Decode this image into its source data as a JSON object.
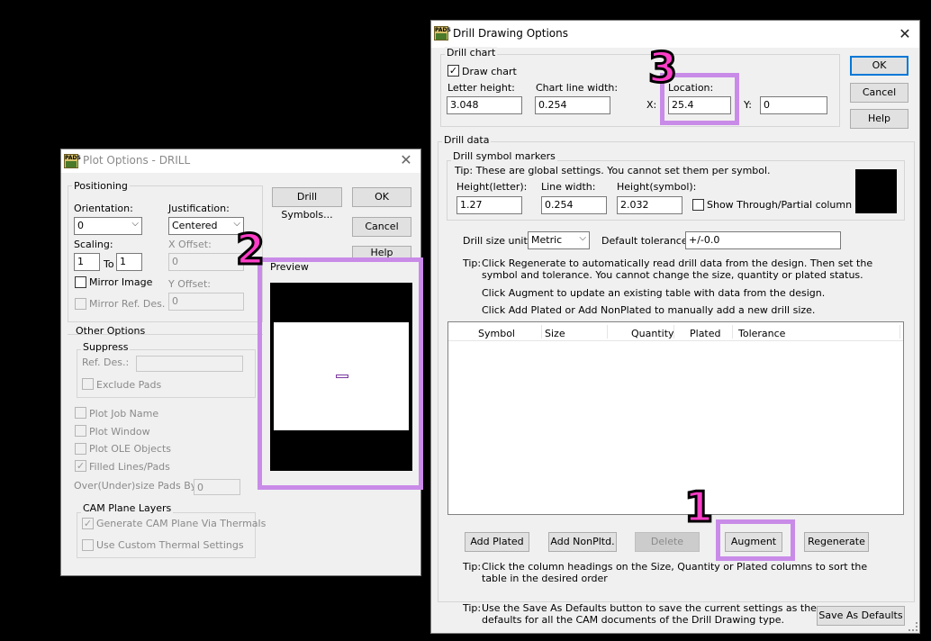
{
  "plot_options": {
    "title": "Plot Options - DRILL",
    "positioning": {
      "label": "Positioning",
      "orientation_label": "Orientation:",
      "orientation_value": "0",
      "justification_label": "Justification:",
      "justification_value": "Centered",
      "scaling_label": "Scaling:",
      "scale_from": "1",
      "scale_to_label": "To",
      "scale_to": "1",
      "x_offset_label": "X Offset:",
      "x_offset_value": "0",
      "y_offset_label": "Y Offset:",
      "y_offset_value": "0",
      "mirror_image": "Mirror Image",
      "mirror_ref_des": "Mirror Ref. Des."
    },
    "buttons": {
      "drill_symbols": "Drill Symbols...",
      "ok": "OK",
      "cancel": "Cancel",
      "help": "Help"
    },
    "preview_label": "Preview",
    "other_options": {
      "label": "Other Options",
      "suppress_label": "Suppress",
      "ref_des_label": "Ref. Des.:",
      "exclude_pads": "Exclude Pads",
      "plot_job_name": "Plot Job Name",
      "plot_window": "Plot Window",
      "plot_ole_objects": "Plot OLE Objects",
      "filled_lines_pads": "Filled Lines/Pads",
      "over_under_label": "Over(Under)size Pads By:",
      "over_under_value": "0",
      "cam_plane_layers_label": "CAM Plane Layers",
      "generate_cam_plane": "Generate CAM Plane Via Thermals",
      "use_custom_thermal": "Use Custom Thermal Settings"
    }
  },
  "drill_drawing": {
    "title": "Drill Drawing Options",
    "drill_chart": {
      "label": "Drill chart",
      "draw_chart": "Draw chart",
      "letter_height_label": "Letter height:",
      "letter_height": "3.048",
      "chart_line_width_label": "Chart line width:",
      "chart_line_width": "0.254",
      "location_label": "Location:",
      "x_label": "X:",
      "x_value": "25.4",
      "y_label": "Y:",
      "y_value": "0"
    },
    "buttons": {
      "ok": "OK",
      "cancel": "Cancel",
      "help": "Help",
      "add_plated": "Add Plated",
      "add_nonpltd": "Add NonPltd.",
      "delete": "Delete",
      "augment": "Augment",
      "regenerate": "Regenerate",
      "save_as_defaults": "Save As Defaults"
    },
    "drill_data": {
      "label": "Drill data",
      "markers_label": "Drill symbol markers",
      "markers_tip": "Tip: These are global settings. You cannot set them per symbol.",
      "height_letter_label": "Height(letter):",
      "height_letter": "1.27",
      "line_width_label": "Line width:",
      "line_width": "0.254",
      "height_symbol_label": "Height(symbol):",
      "height_symbol": "2.032",
      "show_through": "Show Through/Partial column",
      "size_units_label": "Drill size units:",
      "size_units_value": "Metric",
      "default_tolerance_label": "Default tolerance:",
      "default_tolerance": "+/-0.0",
      "tip_prefix": "Tip:",
      "tip_line1": "Click Regenerate to automatically read drill data from the design. Then set the",
      "tip_line2": "symbol and tolerance. You cannot change the size, quantity or plated status.",
      "tip_line3": "Click Augment to update an existing table with data from the design.",
      "tip_line4": "Click Add Plated or Add NonPlated to manually add a new drill size.",
      "columns": [
        "Symbol",
        "Size",
        "Quantity",
        "Plated",
        "Tolerance"
      ],
      "sort_tip_line1": "Click the column headings on the Size, Quantity or Plated columns to sort the",
      "sort_tip_line2": "table in the desired order"
    },
    "footer_tip_line1": "Use the Save As Defaults button to save the current settings as the",
    "footer_tip_line2": "defaults for all the CAM documents of the Drill Drawing type."
  },
  "annotations": [
    "1",
    "2",
    "3"
  ],
  "colors": {
    "highlight": "#c98be8",
    "annotation": "#ff3ec8",
    "accent": "#0078d7"
  }
}
